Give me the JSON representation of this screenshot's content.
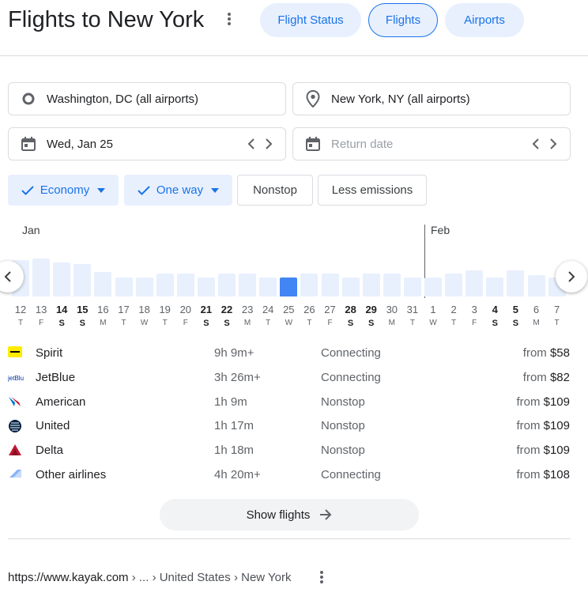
{
  "header": {
    "title": "Flights to New York",
    "tabs": [
      "Flight Status",
      "Flights",
      "Airports"
    ],
    "selected_tab": "Flights"
  },
  "search": {
    "origin": "Washington, DC (all airports)",
    "destination": "New York, NY (all airports)",
    "depart_date": "Wed, Jan 25",
    "return_placeholder": "Return date"
  },
  "filters": {
    "cabin": "Economy",
    "trip_type": "One way",
    "nonstop": "Nonstop",
    "less_emissions": "Less emissions"
  },
  "calendar": {
    "months": [
      "Jan",
      "Feb"
    ],
    "days": [
      {
        "num": "12",
        "letter": "T",
        "level": 0.46,
        "weekend": false
      },
      {
        "num": "13",
        "letter": "F",
        "level": 0.48,
        "weekend": false
      },
      {
        "num": "14",
        "letter": "S",
        "level": 0.43,
        "weekend": true
      },
      {
        "num": "15",
        "letter": "S",
        "level": 0.41,
        "weekend": true
      },
      {
        "num": "16",
        "letter": "M",
        "level": 0.31,
        "weekend": false
      },
      {
        "num": "17",
        "letter": "T",
        "level": 0.24,
        "weekend": false
      },
      {
        "num": "18",
        "letter": "W",
        "level": 0.24,
        "weekend": false
      },
      {
        "num": "19",
        "letter": "T",
        "level": 0.29,
        "weekend": false
      },
      {
        "num": "20",
        "letter": "F",
        "level": 0.29,
        "weekend": false
      },
      {
        "num": "21",
        "letter": "S",
        "level": 0.24,
        "weekend": true
      },
      {
        "num": "22",
        "letter": "S",
        "level": 0.29,
        "weekend": true
      },
      {
        "num": "23",
        "letter": "M",
        "level": 0.29,
        "weekend": false
      },
      {
        "num": "24",
        "letter": "T",
        "level": 0.24,
        "weekend": false
      },
      {
        "num": "25",
        "letter": "W",
        "level": 0.24,
        "weekend": false,
        "selected": true
      },
      {
        "num": "26",
        "letter": "T",
        "level": 0.29,
        "weekend": false
      },
      {
        "num": "27",
        "letter": "F",
        "level": 0.29,
        "weekend": false
      },
      {
        "num": "28",
        "letter": "S",
        "level": 0.24,
        "weekend": true
      },
      {
        "num": "29",
        "letter": "S",
        "level": 0.29,
        "weekend": true
      },
      {
        "num": "30",
        "letter": "M",
        "level": 0.29,
        "weekend": false
      },
      {
        "num": "31",
        "letter": "T",
        "level": 0.24,
        "weekend": false
      },
      {
        "num": "1",
        "letter": "W",
        "level": 0.24,
        "weekend": false
      },
      {
        "num": "2",
        "letter": "T",
        "level": 0.29,
        "weekend": false
      },
      {
        "num": "3",
        "letter": "F",
        "level": 0.33,
        "weekend": false
      },
      {
        "num": "4",
        "letter": "S",
        "level": 0.24,
        "weekend": true
      },
      {
        "num": "5",
        "letter": "S",
        "level": 0.33,
        "weekend": true
      },
      {
        "num": "6",
        "letter": "M",
        "level": 0.27,
        "weekend": false
      },
      {
        "num": "7",
        "letter": "T",
        "level": 0.24,
        "weekend": false
      }
    ]
  },
  "airlines": [
    {
      "name": "Spirit",
      "duration": "9h 9m+",
      "stops": "Connecting",
      "from": "from",
      "price": "$58",
      "logo": "spirit-logo"
    },
    {
      "name": "JetBlue",
      "duration": "3h 26m+",
      "stops": "Connecting",
      "from": "from",
      "price": "$82",
      "logo": "jetblue-logo"
    },
    {
      "name": "American",
      "duration": "1h 9m",
      "stops": "Nonstop",
      "from": "from",
      "price": "$109",
      "logo": "american-logo"
    },
    {
      "name": "United",
      "duration": "1h 17m",
      "stops": "Nonstop",
      "from": "from",
      "price": "$109",
      "logo": "united-logo"
    },
    {
      "name": "Delta",
      "duration": "1h 18m",
      "stops": "Nonstop",
      "from": "from",
      "price": "$109",
      "logo": "delta-logo"
    },
    {
      "name": "Other airlines",
      "duration": "4h 20m+",
      "stops": "Connecting",
      "from": "from",
      "price": "$108",
      "logo": "other-airlines-logo"
    }
  ],
  "show_flights": "Show flights",
  "source": {
    "url": "https://www.kayak.com",
    "path": " › ... › United States › New York"
  },
  "colors": {
    "accent": "#1a73e8",
    "selected_bar": "#4285f4",
    "bar": "#e8f0fe"
  }
}
